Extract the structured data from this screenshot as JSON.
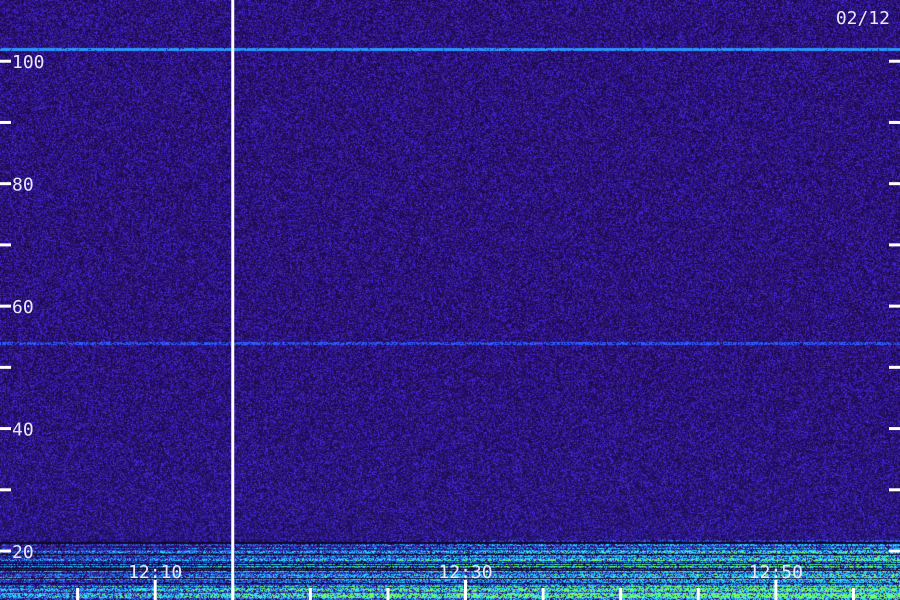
{
  "chart_data": {
    "type": "heatmap",
    "title": "",
    "date_label": "02/12",
    "xlabel": "",
    "ylabel": "",
    "x_range": [
      "12:00",
      "12:58"
    ],
    "ylim": [
      12,
      110
    ],
    "y_tick_labels": [
      {
        "value": 100,
        "label": "100"
      },
      {
        "value": 80,
        "label": "80"
      },
      {
        "value": 60,
        "label": "60"
      },
      {
        "value": 40,
        "label": "40"
      },
      {
        "value": 20,
        "label": "20"
      }
    ],
    "y_minor_ticks": [
      90,
      70,
      50,
      30
    ],
    "x_tick_labels": [
      {
        "value": "12:10",
        "label": "12:10"
      },
      {
        "value": "12:30",
        "label": "12:30"
      },
      {
        "value": "12:50",
        "label": "12:50"
      }
    ],
    "x_tick_marks": [
      "12:05",
      "12:10",
      "12:15",
      "12:20",
      "12:25",
      "12:30",
      "12:35",
      "12:40",
      "12:45",
      "12:50",
      "12:55"
    ],
    "marker_line_time": "12:15",
    "horizontal_lines": [
      {
        "y": 102,
        "strength": "strong"
      },
      {
        "y": 54,
        "strength": "medium"
      }
    ],
    "colors": {
      "background": "#1a0840",
      "noise_low": "#1e0a55",
      "noise_mid": "#3a20b0",
      "noise_high": "#4a3ae0",
      "line": "#2aa8ff",
      "cyan": "#30e0ff",
      "green": "#80ff60",
      "text": "#e8e8ff"
    }
  }
}
